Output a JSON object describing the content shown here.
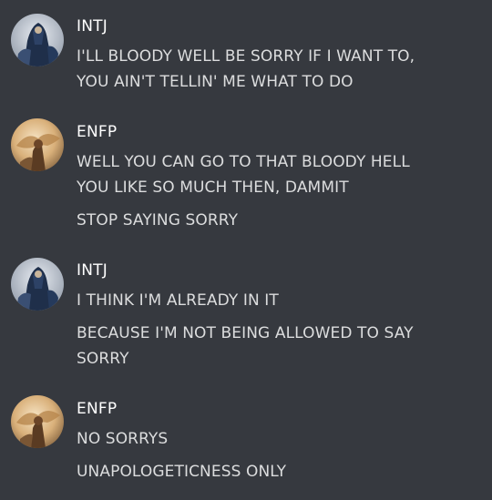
{
  "groups": [
    {
      "username": "INTJ",
      "avatar_icon": "intj-avatar-icon",
      "messages": [
        "I'LL BLOODY WELL BE SORRY IF I WANT TO,\nYOU AIN'T TELLIN' ME WHAT TO DO"
      ]
    },
    {
      "username": "ENFP",
      "avatar_icon": "enfp-avatar-icon",
      "messages": [
        "WELL YOU CAN GO TO THAT BLOODY HELL\nYOU LIKE SO MUCH THEN, DAMMIT",
        "STOP SAYING SORRY"
      ]
    },
    {
      "username": "INTJ",
      "avatar_icon": "intj-avatar-icon",
      "messages": [
        "I THINK I'M ALREADY IN IT",
        "BECAUSE I'M NOT BEING ALLOWED TO SAY\nSORRY"
      ]
    },
    {
      "username": "ENFP",
      "avatar_icon": "enfp-avatar-icon",
      "messages": [
        "NO SORRYS",
        "UNAPOLOGETICNESS ONLY"
      ]
    }
  ],
  "colors": {
    "background": "#36393f",
    "username": "#ffffff",
    "message_text": "#dcddde"
  }
}
